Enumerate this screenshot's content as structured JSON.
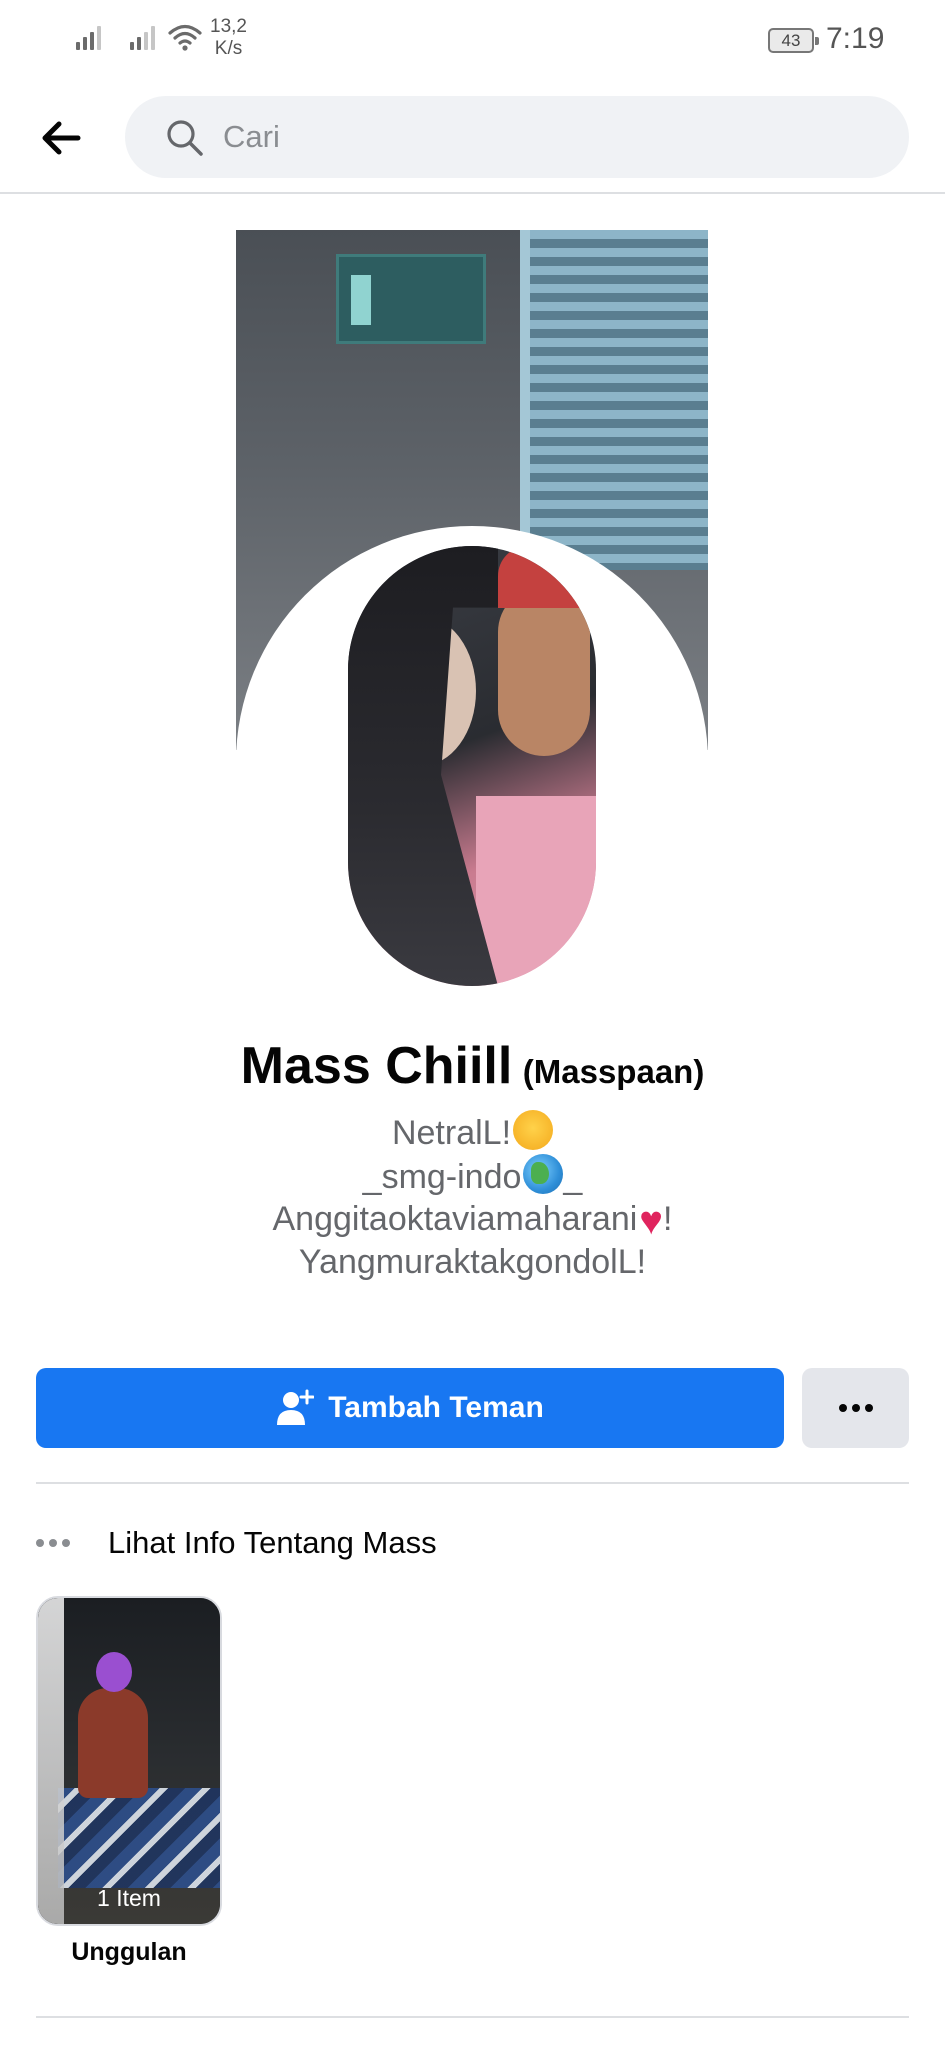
{
  "status_bar": {
    "net_speed_value": "13,2",
    "net_speed_unit": "K/s",
    "battery": "43",
    "time": "7:19"
  },
  "header": {
    "back_icon": "arrow-left-icon",
    "search_icon": "search-icon",
    "search_placeholder": "Cari",
    "search_value": ""
  },
  "profile": {
    "name": "Mass Chiill",
    "alternate_name": "(Masspaan)",
    "bio_lines": [
      {
        "text": "NetralL!",
        "emoji": "hugging-face-emoji"
      },
      {
        "text": "_smg-indo",
        "emoji": "globe-emoji",
        "suffix": "_"
      },
      {
        "text": "Anggitaoktaviamaharani",
        "emoji": "red-heart-emoji",
        "suffix": "!"
      },
      {
        "text": "YangmuraktakgondolL!"
      }
    ]
  },
  "actions": {
    "add_friend_label": "Tambah Teman",
    "add_friend_icon": "add-friend-icon",
    "more_icon": "more-dots-icon",
    "primary_color": "#1877f2"
  },
  "info": {
    "label": "Lihat Info Tentang Mass",
    "icon": "more-dots-icon"
  },
  "featured": {
    "count_label": "1 Item",
    "caption": "Unggulan"
  }
}
